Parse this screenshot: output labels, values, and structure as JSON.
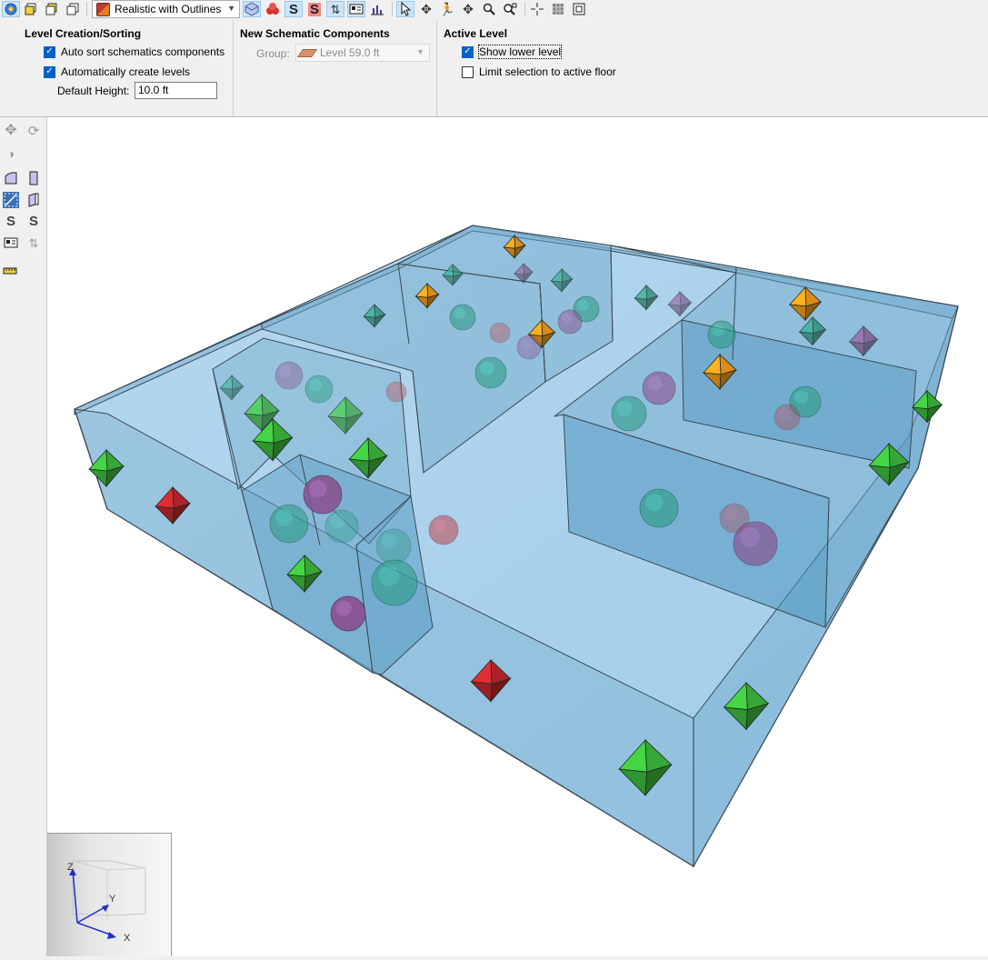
{
  "toolbar": {
    "render_mode": "Realistic with Outlines",
    "icons": [
      "select-level-icon",
      "floor-copy-icon",
      "floor-paste-icon",
      "floor-stack-icon",
      "cube-icon",
      "spheres-icon",
      "schematic-s-icon",
      "schematic-s-red-icon",
      "split-icon",
      "label-icon",
      "chart-icon",
      "pointer-icon",
      "orbit-icon",
      "walk-icon",
      "pan-icon",
      "zoom-icon",
      "zoom-extents-icon",
      "crosshair-icon",
      "grid-icon",
      "fit-icon"
    ]
  },
  "ribbon": {
    "level_creation": {
      "title": "Level Creation/Sorting",
      "auto_sort_label": "Auto sort schematics components",
      "auto_sort_checked": true,
      "auto_create_label": "Automatically create levels",
      "auto_create_checked": true,
      "default_height_label": "Default Height:",
      "default_height_value": "10.0 ft"
    },
    "new_schematic": {
      "title": "New Schematic Components",
      "group_label": "Group:",
      "group_value": "Level 59.0 ft"
    },
    "active_level": {
      "title": "Active Level",
      "show_lower_label": "Show lower level",
      "show_lower_checked": true,
      "limit_label": "Limit selection to active floor",
      "limit_checked": false
    }
  },
  "left_tools": [
    "move-icon",
    "rotate-icon",
    "paint-icon",
    "slab-icon",
    "wall-icon",
    "diagonal-icon",
    "door-icon",
    "s-path-icon",
    "s-path-alt-icon",
    "label-icon",
    "split-icon",
    "ruler-icon"
  ],
  "navcube": {
    "z_label": "Z",
    "y_label": "Y",
    "x_label": "X"
  },
  "colors": {
    "box_fill": "#6fa9c9",
    "box_edge": "#3c4a55",
    "floor_fill": "#8ec1e4",
    "green_marker": "#3cb93c",
    "orange_marker": "#f39a1c",
    "red_marker": "#c1272d",
    "teal_marker": "#2f9e86",
    "purple_marker": "#8a4f8e"
  }
}
